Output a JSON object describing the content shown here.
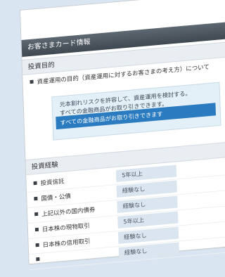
{
  "card": {
    "title": "お客さまカード情報",
    "sections": {
      "purpose": {
        "heading": "投資目的",
        "question": "資産運用の目的（資産運用に対するお客さまの考え方）について",
        "options": [
          "元本割れリスクを許容して、資産運用を検討する。",
          "すべての金融商品がお取り引きできます。"
        ],
        "selected": "すべての金融商品がお取り引きできます"
      },
      "experience": {
        "heading": "投資経験",
        "rows": [
          {
            "label": "投資信託",
            "value": "5年以上"
          },
          {
            "label": "国債・公債",
            "value": "経験なし"
          },
          {
            "label": "上記以外の国内債券",
            "value": "経験なし"
          },
          {
            "label": "日本株の現物取引",
            "value": "5年以上"
          },
          {
            "label": "日本株の信用取引",
            "value": "経験なし"
          },
          {
            "label": "",
            "value": "経験なし"
          }
        ]
      }
    }
  }
}
